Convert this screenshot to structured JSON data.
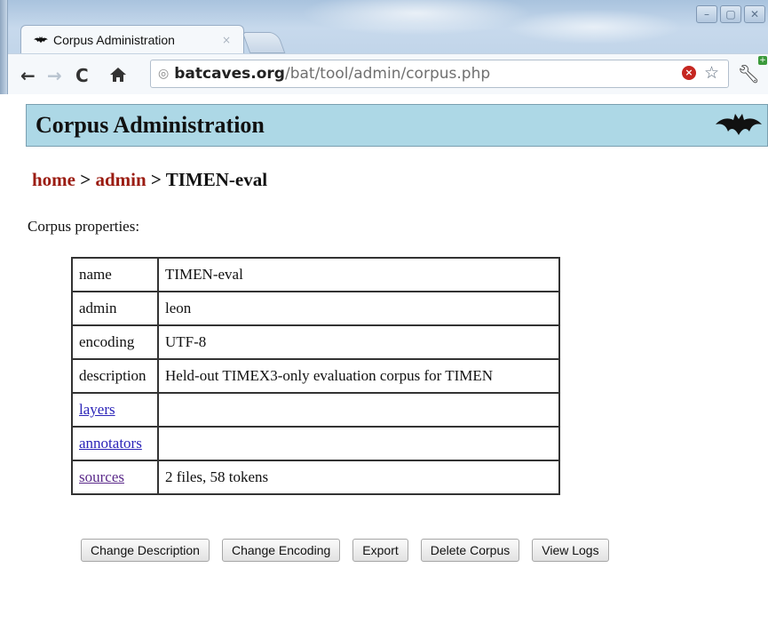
{
  "browser": {
    "tab_title": "Corpus Administration",
    "tab_close": "×",
    "url_host": "batcaves.org",
    "url_path": "/bat/tool/admin/corpus.php"
  },
  "page": {
    "title": "Corpus Administration",
    "breadcrumb": {
      "home": "home",
      "sep1": " > ",
      "admin": "admin",
      "sep2": " > ",
      "current": "TIMEN-eval"
    },
    "section_label": "Corpus properties:",
    "properties": [
      {
        "key": "name",
        "value": "TIMEN-eval"
      },
      {
        "key": "admin",
        "value": "leon"
      },
      {
        "key": "encoding",
        "value": "UTF-8"
      },
      {
        "key": "description",
        "value": "Held-out TIMEX3-only evaluation corpus for TIMEN"
      },
      {
        "key": "layers",
        "value": ""
      },
      {
        "key": "annotators",
        "value": ""
      },
      {
        "key": "sources",
        "value": "2 files, 58 tokens"
      }
    ],
    "buttons": {
      "change_description": "Change Description",
      "change_encoding": "Change Encoding",
      "export": "Export",
      "delete_corpus": "Delete Corpus",
      "view_logs": "View Logs"
    }
  },
  "colors": {
    "header_bg": "#add8e6",
    "breadcrumb_link": "#9b1c12",
    "link": "#2b24b8",
    "visited_link": "#5b2a8a"
  },
  "icons": [
    "bat-icon",
    "back-icon",
    "forward-icon",
    "reload-icon",
    "home-icon",
    "globe-icon",
    "blocked-icon",
    "star-icon",
    "wrench-icon",
    "minimize-icon",
    "maximize-icon",
    "close-icon"
  ]
}
